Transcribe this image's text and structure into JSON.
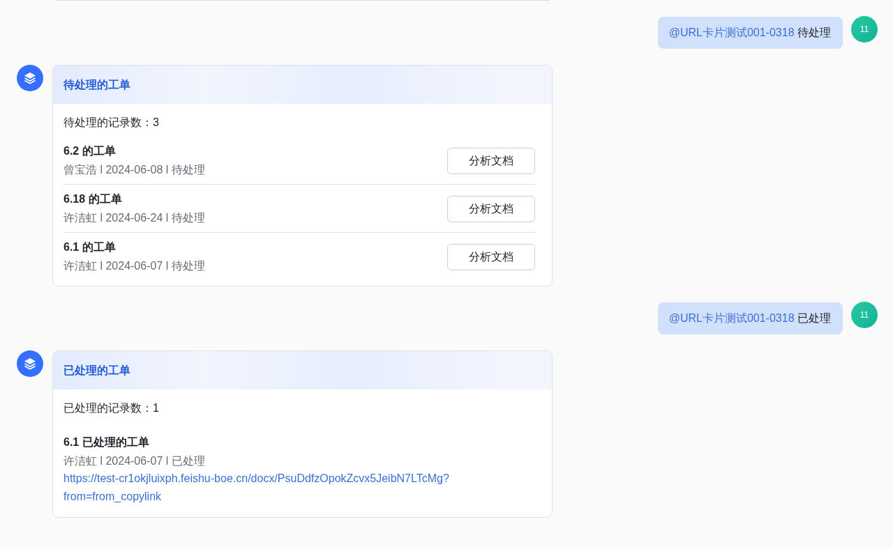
{
  "messages": [
    {
      "kind": "user",
      "mention": "@URL卡片测试001-0318",
      "text": "待处理",
      "avatar": "11"
    },
    {
      "kind": "bot",
      "card": {
        "title": "待处理的工单",
        "count": "待处理的记录数：3",
        "items": [
          {
            "kind": "action",
            "title": "6.2 的工单",
            "meta": "曾宝浩 l 2024-06-08 l 待处理",
            "button": "分析文档"
          },
          {
            "kind": "action",
            "title": "6.18 的工单",
            "meta": "许洁虹 l 2024-06-24 l 待处理",
            "button": "分析文档"
          },
          {
            "kind": "action",
            "title": "6.1 的工单",
            "meta": "许洁虹 l 2024-06-07 l 待处理",
            "button": "分析文档"
          }
        ]
      }
    },
    {
      "kind": "user",
      "mention": "@URL卡片测试001-0318",
      "text": "已处理",
      "avatar": "11"
    },
    {
      "kind": "bot",
      "card": {
        "title": "已处理的工单",
        "count": "已处理的记录数：1",
        "items": [
          {
            "kind": "link",
            "title": "6.1 已处理的工单",
            "meta": "许洁虹 l 2024-06-07 l 已处理",
            "link": " https://test-cr1okjluixph.feishu-boe.cn/docx/PsuDdfzOpokZcvx5JeibN7LTcMg?from=from_copylink"
          }
        ]
      }
    }
  ]
}
